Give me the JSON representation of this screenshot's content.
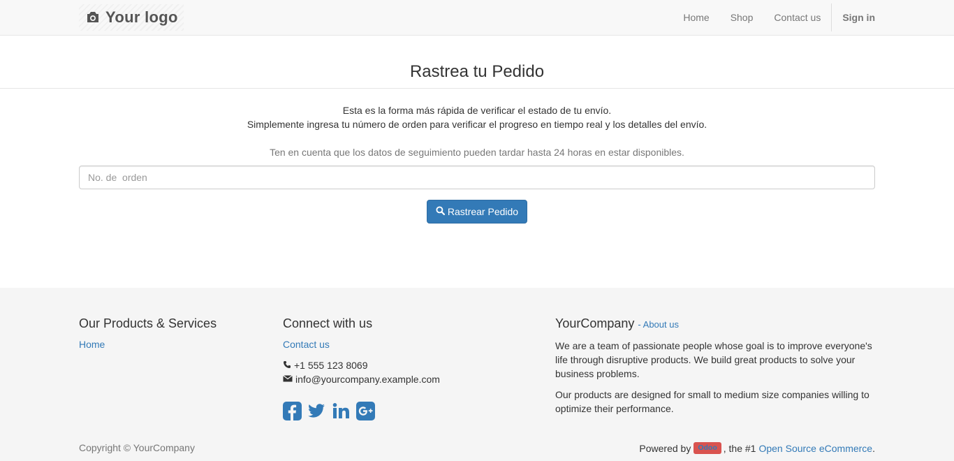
{
  "header": {
    "logo_text": "Your logo",
    "nav": [
      "Home",
      "Shop",
      "Contact us"
    ],
    "signin": "Sign in"
  },
  "main": {
    "title": "Rastrea tu Pedido",
    "intro_line1": "Esta es la forma más rápida de verificar el estado de tu envío.",
    "intro_line2": "Simplemente ingresa tu número de orden para verificar el progreso en tiempo real y los detalles del envío.",
    "note": "Ten en cuenta que los datos de seguimiento pueden tardar hasta 24 horas en estar disponibles.",
    "order_placeholder": "No. de  orden",
    "order_value": "",
    "track_button": "Rastrear Pedido"
  },
  "footer": {
    "products_title": "Our Products & Services",
    "products_links": [
      "Home"
    ],
    "connect_title": "Connect with us",
    "contact_link": "Contact us",
    "phone": "+1 555 123 8069",
    "email": "info@yourcompany.example.com",
    "social_icons": [
      "facebook-icon",
      "twitter-icon",
      "linkedin-icon",
      "google-plus-icon"
    ],
    "company_name": "YourCompany",
    "about_link": "- About us",
    "about_p1": "We are a team of passionate people whose goal is to improve everyone's life through disruptive products. We build great products to solve your business problems.",
    "about_p2": "Our products are designed for small to medium size companies willing to optimize their performance.",
    "copyright": "Copyright © YourCompany",
    "powered_prefix": "Powered by",
    "odoo_badge": "Odoo",
    "powered_middle": ", the #1",
    "powered_link": "Open Source eCommerce",
    "powered_suffix": "."
  },
  "colors": {
    "primary": "#337ab7",
    "badge": "#d9534f",
    "footer_bg": "#f5f5f5",
    "navbar_bg": "#f8f8f8"
  }
}
